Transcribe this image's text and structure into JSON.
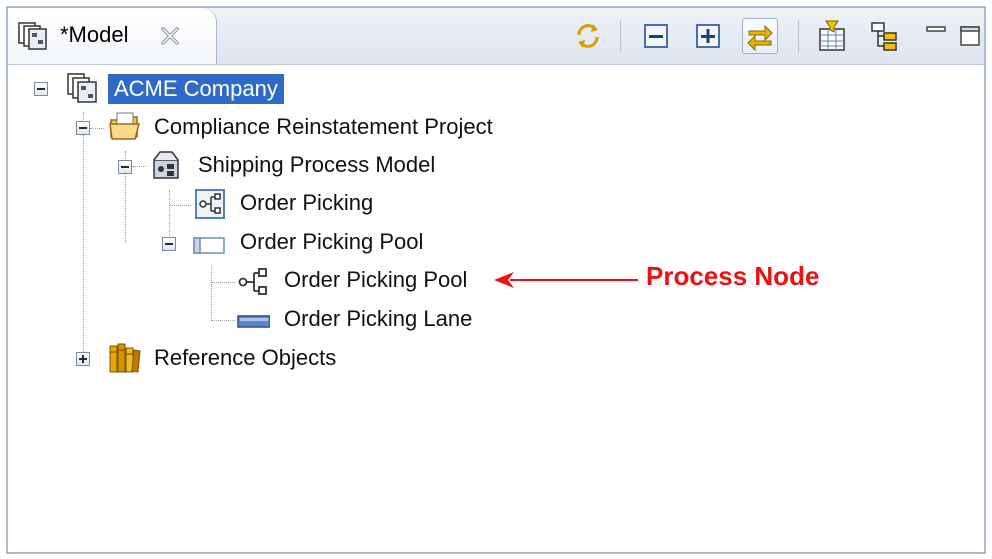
{
  "view": {
    "tab_title": "*Model",
    "tab_icon": "model-view-icon",
    "close_icon": "close-icon",
    "toolbar": [
      {
        "name": "sync-icon"
      },
      {
        "name": "collapse-all-icon"
      },
      {
        "name": "expand-all-icon"
      },
      {
        "name": "link-with-editor-icon",
        "pressed": true
      },
      {
        "name": "filter-icon"
      },
      {
        "name": "tree-layout-icon"
      },
      {
        "name": "minimize-icon"
      },
      {
        "name": "maximize-icon"
      }
    ]
  },
  "tree": {
    "root": {
      "label": "ACME Company",
      "icon": "company-icon",
      "selected": true
    },
    "project": {
      "label": "Compliance Reinstatement Project",
      "icon": "open-folder-icon"
    },
    "model": {
      "label": "Shipping Process Model",
      "icon": "process-model-icon"
    },
    "process": {
      "label": "Order Picking",
      "icon": "process-diagram-icon"
    },
    "pool": {
      "label": "Order Picking Pool",
      "icon": "pool-icon"
    },
    "pool_process": {
      "label": "Order Picking Pool",
      "icon": "process-node-icon"
    },
    "lane": {
      "label": "Order Picking Lane",
      "icon": "lane-icon"
    },
    "reference": {
      "label": "Reference Objects",
      "icon": "books-icon"
    }
  },
  "annotation": {
    "label": "Process Node",
    "color": "#ee1111"
  },
  "colors": {
    "selection": "#3169c6",
    "border": "#a9b8cf"
  }
}
